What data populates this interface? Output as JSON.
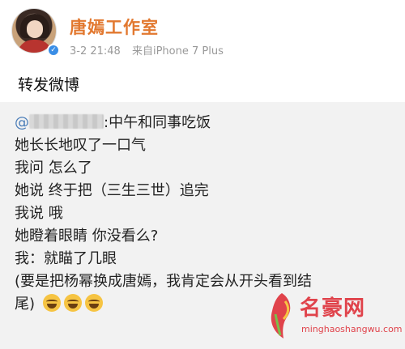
{
  "header": {
    "username": "唐嫣工作室",
    "verified_badge": "✓",
    "date": "3-2 21:48",
    "source": "来自iPhone 7 Plus"
  },
  "post": {
    "text": "转发微博"
  },
  "quoted_post": {
    "mention_suffix": ":中午和同事吃饭",
    "lines": [
      "她长长地叹了一口气",
      "我问 怎么了",
      "她说 终于把（三生三世）追完",
      "我说 哦",
      "她瞪着眼睛 你没看么?",
      "我：就瞄了几眼",
      "(要是把杨幂换成唐嫣，我肯定会从开头看到结",
      "尾)"
    ],
    "emoji_icon": "laughing-crying-emoji"
  },
  "watermark": {
    "title": "名豪网",
    "domain": "minghaoshangwu.com"
  },
  "colors": {
    "username": "#e2782f",
    "mention": "#4a7db8",
    "quoted_bg": "#f2f2f2",
    "watermark": "#e0434b"
  }
}
